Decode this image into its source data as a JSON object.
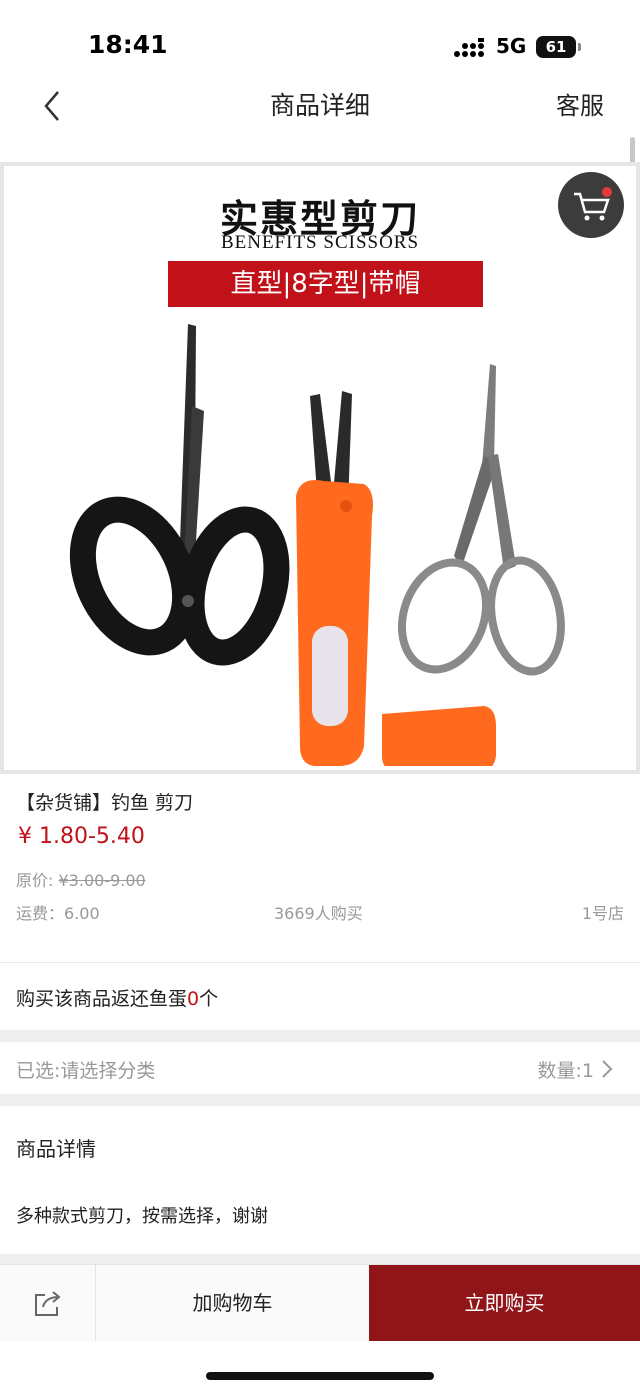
{
  "status_bar": {
    "time": "18:41",
    "network": "5G",
    "battery": "61"
  },
  "nav": {
    "title": "商品详细",
    "service_label": "客服"
  },
  "hero": {
    "title": "实惠型剪刀",
    "subtitle": "BENEFITS SCISSORS",
    "banner": "直型|8字型|带帽"
  },
  "product": {
    "name": "【杂货铺】钓鱼 剪刀",
    "price": "¥ 1.80-5.40",
    "original_label": "原价:",
    "original_price": "¥3.00-9.00",
    "shipping": "运费：6.00",
    "buyers": "3669人购买",
    "store": "1号店"
  },
  "rebate": {
    "prefix": "购买该商品返还鱼蛋",
    "count": "0",
    "suffix": "个"
  },
  "selection": {
    "selected": "已选:请选择分类",
    "quantity": "数量:1"
  },
  "details": {
    "title": "商品详情",
    "text": "多种款式剪刀，按需选择，谢谢"
  },
  "bottom_bar": {
    "add_to_cart": "加购物车",
    "buy_now": "立即购买"
  },
  "colors": {
    "accent": "#c1121a",
    "buy_button": "#8f1519"
  }
}
